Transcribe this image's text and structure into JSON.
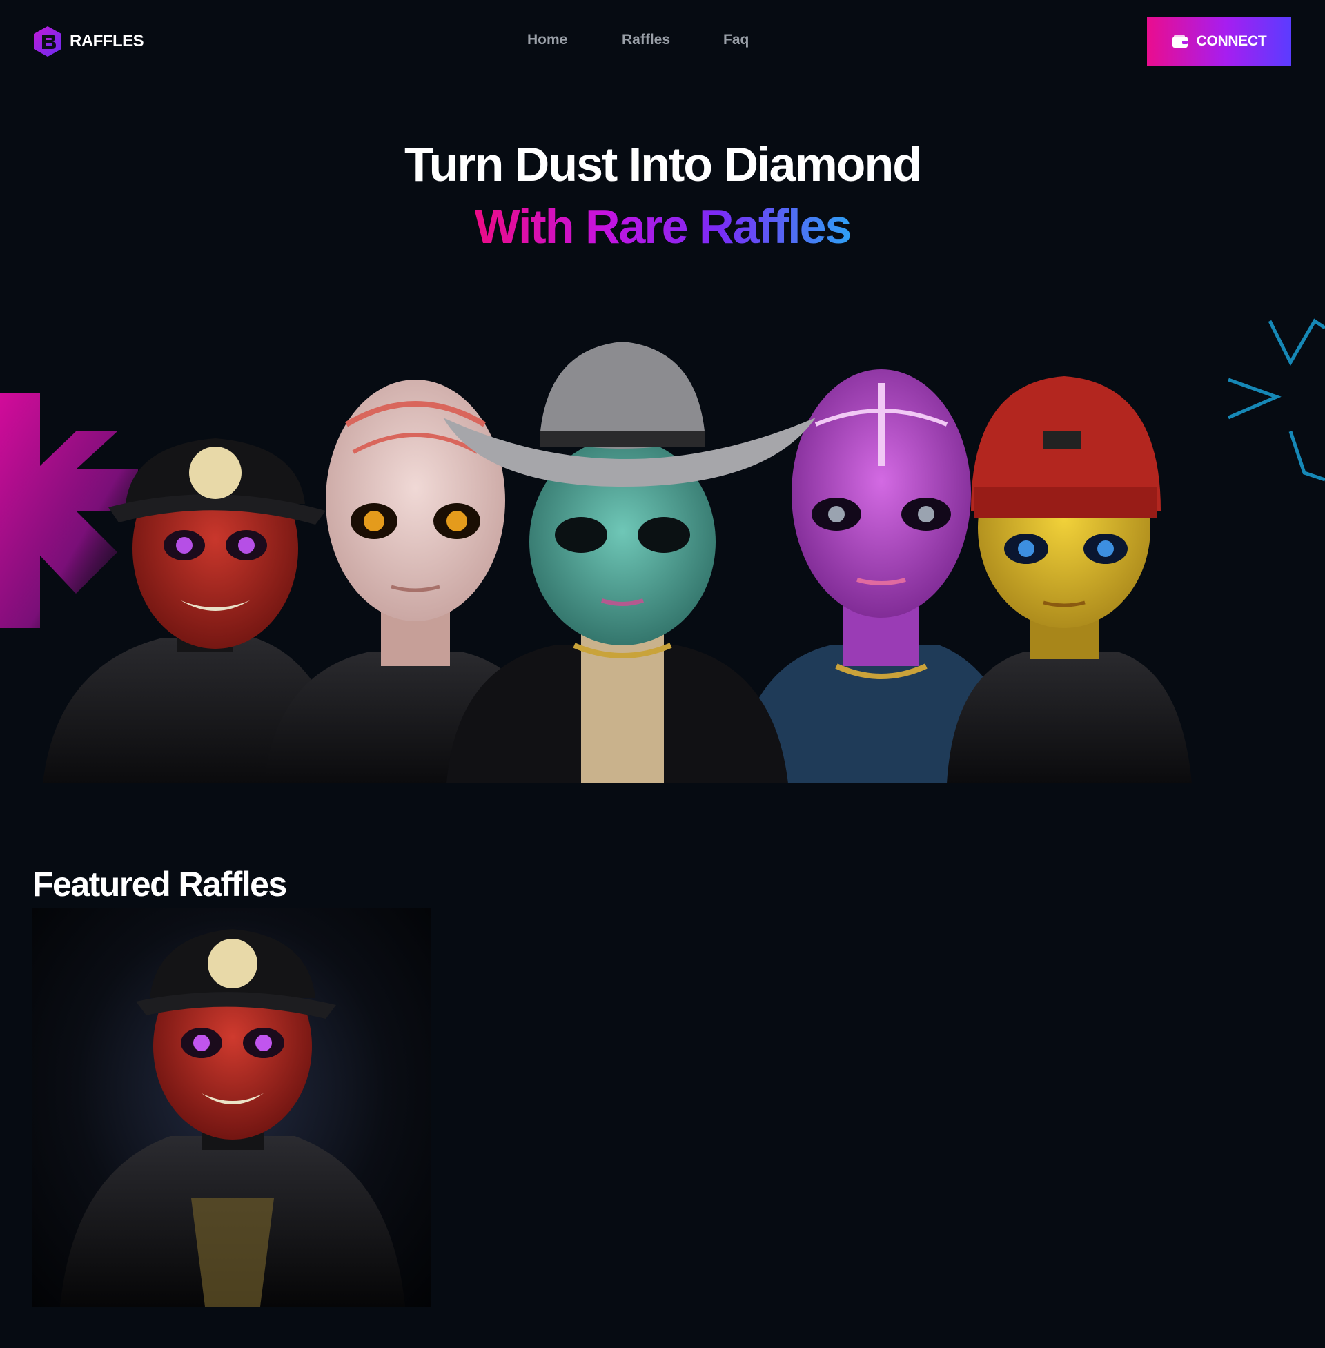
{
  "brand": {
    "name": "RAFFLES",
    "logo_icon": "raffles-logo-icon"
  },
  "nav": {
    "links": [
      {
        "label": "Home"
      },
      {
        "label": "Raffles"
      },
      {
        "label": "Faq"
      }
    ],
    "connect_label": "CONNECT",
    "connect_icon": "wallet-icon"
  },
  "hero": {
    "line1": "Turn Dust Into Diamond",
    "line2": "With Rare Raffles",
    "characters": [
      "alien-red-cap",
      "alien-pale-patterned",
      "alien-teal-cowboy-hat",
      "alien-purple",
      "alien-yellow-red-beanie"
    ]
  },
  "featured": {
    "title": "Featured Raffles",
    "items": [
      {
        "image": "alien-red-cap"
      }
    ]
  },
  "colors": {
    "background": "#060b12",
    "accent_pink": "#ea0d8e",
    "accent_purple": "#a61ef0",
    "accent_blue": "#2fa0f4",
    "nav_text": "#9aa0a8"
  }
}
